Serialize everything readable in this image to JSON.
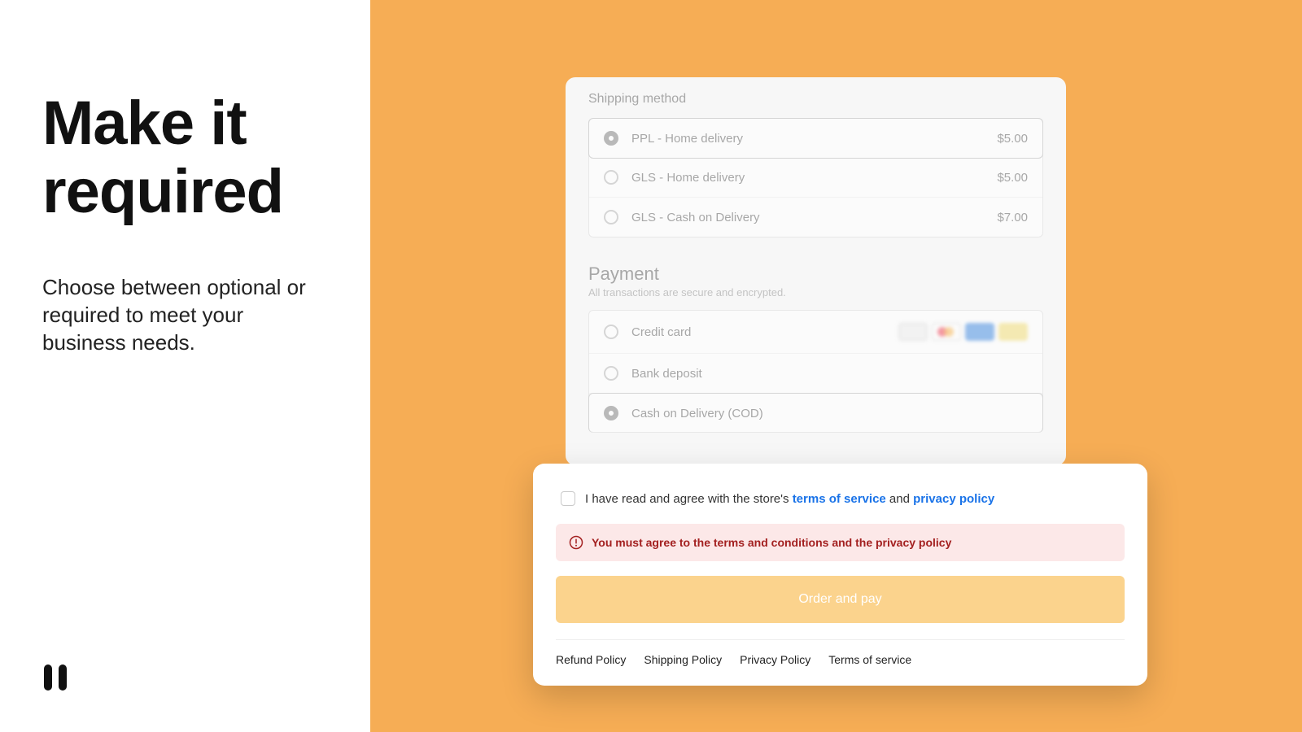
{
  "left": {
    "headline": "Make it required",
    "subtext": "Choose between optional or required to meet your business needs."
  },
  "checkout": {
    "shipping_heading": "Shipping method",
    "shipping": [
      {
        "label": "PPL - Home delivery",
        "price": "$5.00",
        "selected": true
      },
      {
        "label": "GLS - Home delivery",
        "price": "$5.00",
        "selected": false
      },
      {
        "label": "GLS - Cash on Delivery",
        "price": "$7.00",
        "selected": false
      }
    ],
    "payment_heading": "Payment",
    "payment_sub": "All transactions are secure and encrypted.",
    "payment": [
      {
        "label": "Credit card",
        "brands": true,
        "selected": false
      },
      {
        "label": "Bank deposit",
        "brands": false,
        "selected": false
      },
      {
        "label": "Cash on Delivery (COD)",
        "brands": false,
        "selected": true
      }
    ]
  },
  "consent": {
    "prefix": "I have read and agree with the store's ",
    "tos": "terms of service",
    "mid": " and ",
    "pp": "privacy policy"
  },
  "error": {
    "message": "You must agree to the terms and conditions and the privacy policy"
  },
  "cta": {
    "order_label": "Order and pay"
  },
  "footer_links": [
    "Refund Policy",
    "Shipping Policy",
    "Privacy Policy",
    "Terms of service"
  ]
}
